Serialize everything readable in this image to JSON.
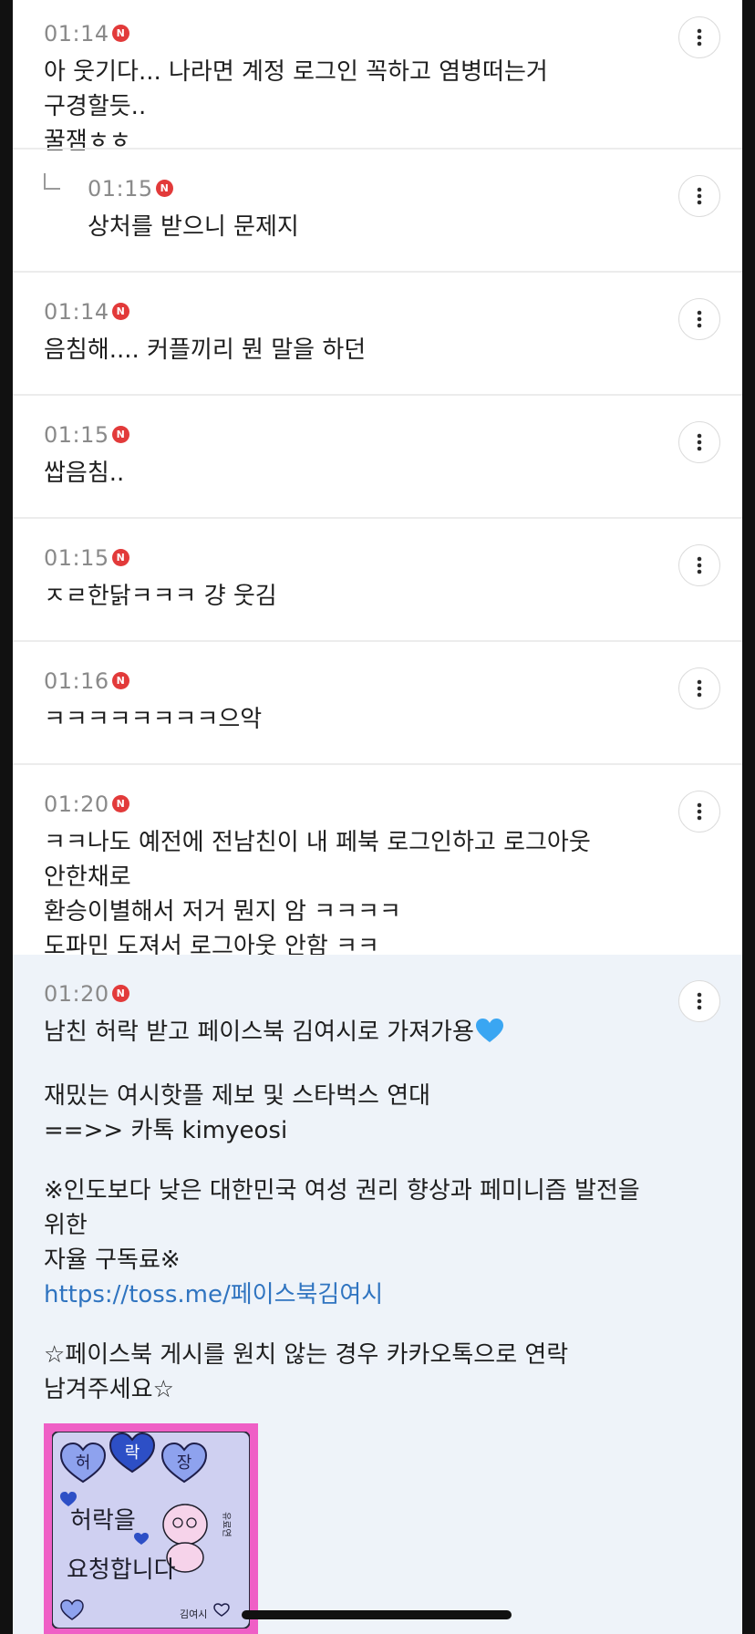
{
  "colors": {
    "accent": "#e23a3a",
    "link": "#2f74c0",
    "author_bg": "#eef3f9",
    "image_bg": "#ef5fc6"
  },
  "icons": {
    "badge": "new-badge-icon",
    "more": "more-vertical-icon",
    "reply": "reply-arrow-icon",
    "heart": "blue-heart-emoji"
  },
  "badge_letter": "N",
  "comments": [
    {
      "time": "01:14",
      "text": "아 웃기다... 나라면 계정 로그인 꼭하고 염병떠는거 구경할듯..\n꿀잼ㅎㅎ"
    },
    {
      "time": "01:15",
      "text": "상처를 받으니 문제지"
    },
    {
      "time": "01:14",
      "text": "음침해.... 커플끼리 뭔 말을 하던"
    },
    {
      "time": "01:15",
      "text": "쌉음침.."
    },
    {
      "time": "01:15",
      "text": "ㅈㄹ한닭ㅋㅋㅋ 걍 웃김"
    },
    {
      "time": "01:16",
      "text": "ㅋㅋㅋㅋㅋㅋㅋㅋ으악"
    },
    {
      "time": "01:20",
      "text": "ㅋㅋ나도 예전에 전남친이 내 페북 로그인하고 로그아웃 안한채로\n환승이별해서 저거 뭔지 암 ㅋㅋㅋㅋ\n도파민 도져서 로그아웃 안함 ㅋㅋ"
    }
  ],
  "author_comment": {
    "time": "01:20",
    "line1": "남친 허락 받고 페이스북 김여시로 가져가용",
    "tip_line1": "재밌는 여시핫플 제보 및 스타벅스 연대",
    "tip_line2": "==>> 카톡 kimyeosi",
    "sub_line1": "※인도보다 낮은 대한민국 여성 권리 향상과 페미니즘 발전을 위한",
    "sub_line2": "자율 구독료※",
    "link": "https://toss.me/페이스북김여시",
    "notice_line1": "☆페이스북 게시를 원치 않는 경우 카카오톡으로 연락",
    "notice_line2": "남겨주세요☆",
    "image": {
      "title_chars": [
        "허",
        "락",
        "장"
      ],
      "line1": "허락을",
      "line2": "요청합니다",
      "side_text": "유료연",
      "signature": "김여시"
    }
  }
}
